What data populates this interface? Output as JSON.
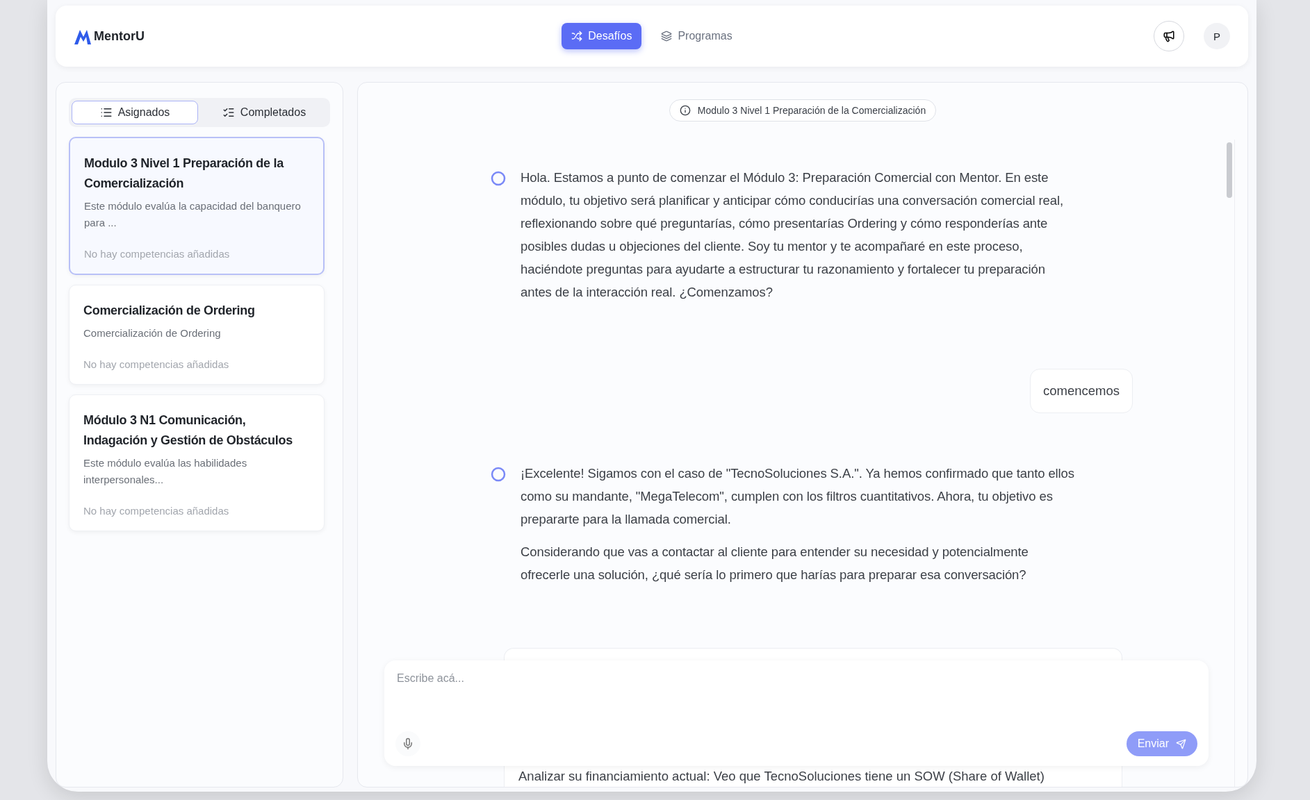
{
  "header": {
    "logo": "MentorU",
    "nav": [
      {
        "label": "Desafíos",
        "selected": true
      },
      {
        "label": "Programas",
        "selected": false
      }
    ],
    "avatar": "P"
  },
  "sidebar": {
    "tabs": [
      {
        "label": "Asignados",
        "selected": true
      },
      {
        "label": "Completados",
        "selected": false
      }
    ],
    "challenges": [
      {
        "title": "Modulo 3 Nivel 1 Preparación de la Comercialización",
        "description": "Este módulo evalúa la capacidad del banquero para ...",
        "competencies": "No hay competencias añadidas",
        "selected": true
      },
      {
        "title": "Comercialización de Ordering",
        "description": "Comercialización de Ordering",
        "competencies": "No hay competencias añadidas",
        "selected": false
      },
      {
        "title": "Módulo 3 N1 Comunicación, Indagación y Gestión de Obstáculos",
        "description": "Este módulo evalúa las habilidades interpersonales...",
        "competencies": "No hay competencias añadidas",
        "selected": false
      }
    ]
  },
  "chat": {
    "topic": "Modulo 3 Nivel 1 Preparación de la Comercialización",
    "messages": [
      {
        "kind": "mentor",
        "paragraphs": [
          "Hola. Estamos a punto de comenzar el Módulo 3: Preparación Comercial con Mentor. En este módulo, tu objetivo será planificar y anticipar cómo conducirías una conversación comercial real, reflexionando sobre qué preguntarías, cómo presentarías Ordering y cómo responderías ante posibles dudas u objeciones del cliente. Soy tu mentor y te acompañaré en este proceso, haciéndote preguntas para ayudarte a estructurar tu razonamiento y fortalecer tu preparación antes de la interacción real. ¿Comenzamos?"
        ]
      },
      {
        "kind": "user",
        "text": "comencemos"
      },
      {
        "kind": "mentor",
        "paragraphs": [
          "¡Excelente! Sigamos con el caso de \"TecnoSoluciones S.A.\". Ya hemos confirmado que tanto ellos como su mandante, \"MegaTelecom\", cumplen con los filtros cuantitativos. Ahora, tu objetivo es prepararte para la llamada comercial.",
          "Considerando que vas a contactar al cliente para entender su necesidad y potencialmente ofrecerle una solución, ¿qué sería lo primero que harías para preparar esa conversación?"
        ]
      },
      {
        "kind": "user_partial",
        "text": "Analizar su financiamiento actual: Veo que TecnoSoluciones tiene un SOW (Share of Wallet)"
      }
    ],
    "composer": {
      "placeholder": "Escribe acá...",
      "send": "Enviar",
      "send_disabled": true
    }
  }
}
